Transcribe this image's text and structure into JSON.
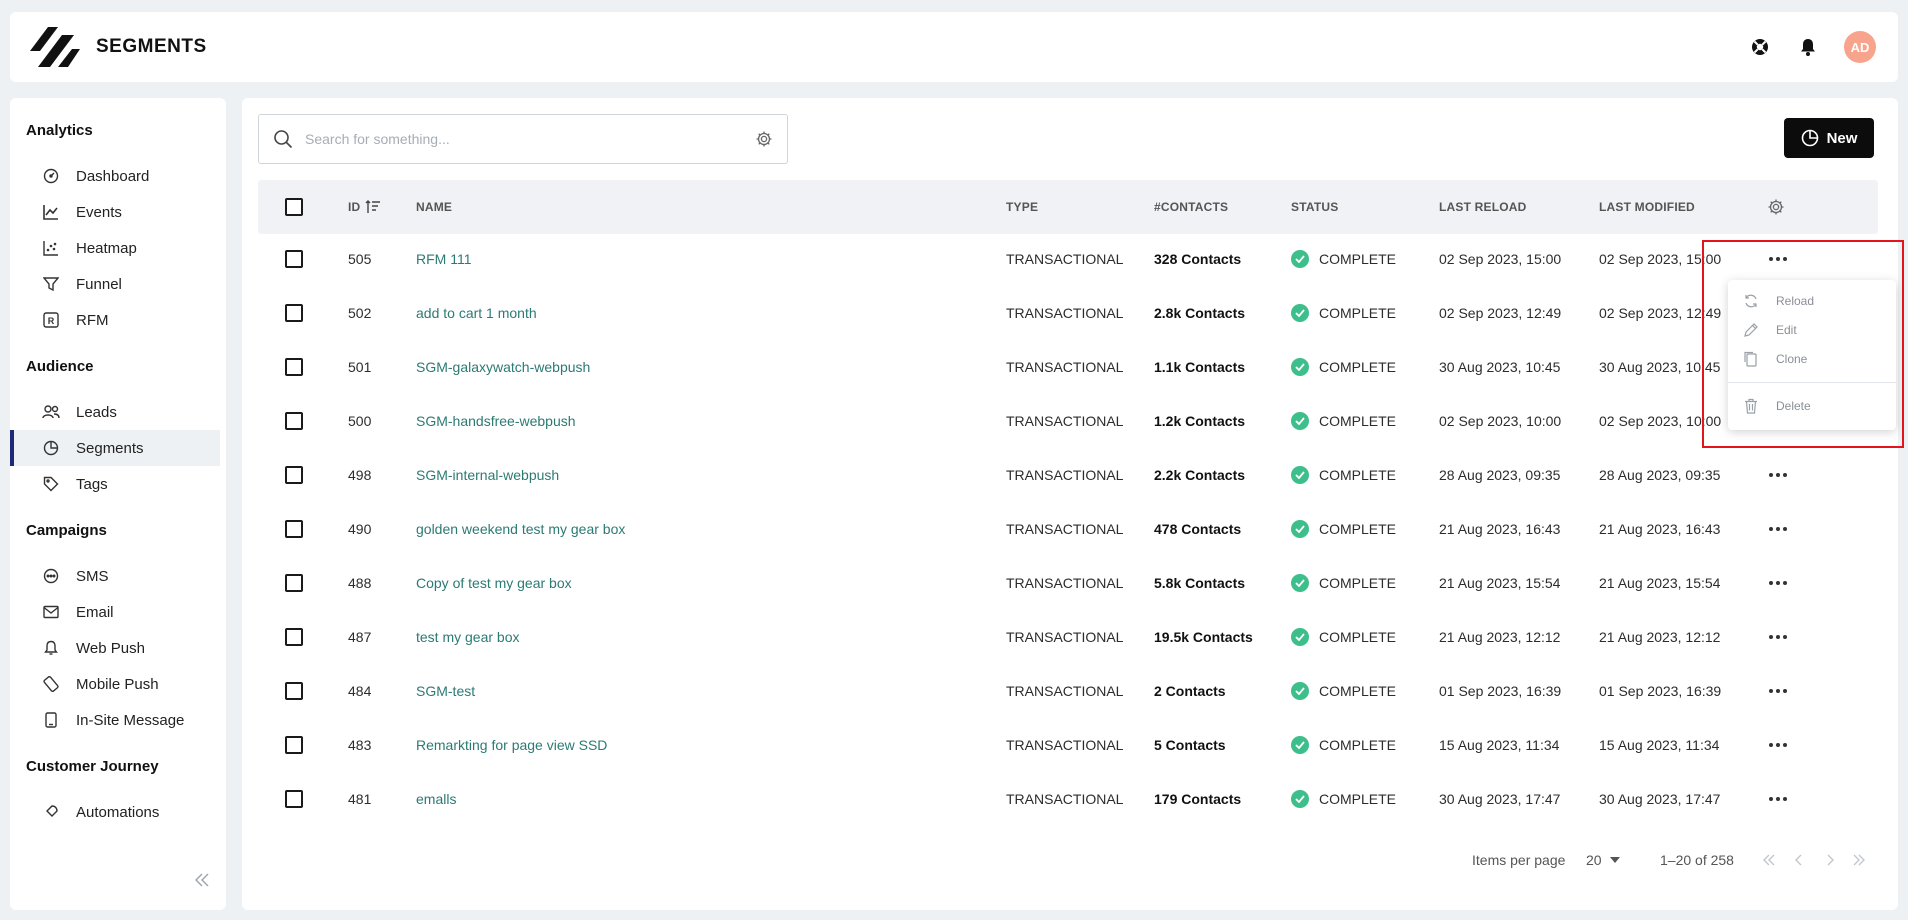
{
  "header": {
    "title": "SEGMENTS",
    "avatar_initials": "AD"
  },
  "sidebar": {
    "sections": [
      {
        "title": "Analytics",
        "items": [
          {
            "label": "Dashboard",
            "icon": "dashboard-icon"
          },
          {
            "label": "Events",
            "icon": "line-chart-icon"
          },
          {
            "label": "Heatmap",
            "icon": "scatter-icon"
          },
          {
            "label": "Funnel",
            "icon": "funnel-icon"
          },
          {
            "label": "RFM",
            "icon": "rfm-icon"
          }
        ]
      },
      {
        "title": "Audience",
        "items": [
          {
            "label": "Leads",
            "icon": "users-icon"
          },
          {
            "label": "Segments",
            "icon": "pie-icon",
            "active": true
          },
          {
            "label": "Tags",
            "icon": "tag-icon"
          }
        ]
      },
      {
        "title": "Campaigns",
        "items": [
          {
            "label": "SMS",
            "icon": "chat-icon"
          },
          {
            "label": "Email",
            "icon": "mail-icon"
          },
          {
            "label": "Web Push",
            "icon": "bell-icon"
          },
          {
            "label": "Mobile Push",
            "icon": "mobile-push-icon"
          },
          {
            "label": "In-Site Message",
            "icon": "tablet-icon"
          }
        ]
      },
      {
        "title": "Customer Journey",
        "items": [
          {
            "label": "Automations",
            "icon": "rocket-icon"
          }
        ]
      }
    ]
  },
  "toolbar": {
    "search_placeholder": "Search for something...",
    "new_label": "New"
  },
  "table": {
    "headers": {
      "id": "ID",
      "name": "NAME",
      "type": "TYPE",
      "contacts": "#CONTACTS",
      "status": "STATUS",
      "last_reload": "LAST RELOAD",
      "last_modified": "LAST MODIFIED"
    },
    "rows": [
      {
        "id": "505",
        "name": "RFM 111",
        "type": "TRANSACTIONAL",
        "contacts": "328 Contacts",
        "status": "COMPLETE",
        "last_reload": "02 Sep 2023, 15:00",
        "last_modified": "02 Sep 2023, 15:00"
      },
      {
        "id": "502",
        "name": "add to cart 1 month",
        "type": "TRANSACTIONAL",
        "contacts": "2.8k Contacts",
        "status": "COMPLETE",
        "last_reload": "02 Sep 2023, 12:49",
        "last_modified": "02 Sep 2023, 12:49"
      },
      {
        "id": "501",
        "name": "SGM-galaxywatch-webpush",
        "type": "TRANSACTIONAL",
        "contacts": "1.1k Contacts",
        "status": "COMPLETE",
        "last_reload": "30 Aug 2023, 10:45",
        "last_modified": "30 Aug 2023, 10:45"
      },
      {
        "id": "500",
        "name": "SGM-handsfree-webpush",
        "type": "TRANSACTIONAL",
        "contacts": "1.2k Contacts",
        "status": "COMPLETE",
        "last_reload": "02 Sep 2023, 10:00",
        "last_modified": "02 Sep 2023, 10:00"
      },
      {
        "id": "498",
        "name": "SGM-internal-webpush",
        "type": "TRANSACTIONAL",
        "contacts": "2.2k Contacts",
        "status": "COMPLETE",
        "last_reload": "28 Aug 2023, 09:35",
        "last_modified": "28 Aug 2023, 09:35"
      },
      {
        "id": "490",
        "name": "golden weekend test my gear box",
        "type": "TRANSACTIONAL",
        "contacts": "478 Contacts",
        "status": "COMPLETE",
        "last_reload": "21 Aug 2023, 16:43",
        "last_modified": "21 Aug 2023, 16:43"
      },
      {
        "id": "488",
        "name": "Copy of test my gear box",
        "type": "TRANSACTIONAL",
        "contacts": "5.8k Contacts",
        "status": "COMPLETE",
        "last_reload": "21 Aug 2023, 15:54",
        "last_modified": "21 Aug 2023, 15:54"
      },
      {
        "id": "487",
        "name": "test my gear box",
        "type": "TRANSACTIONAL",
        "contacts": "19.5k Contacts",
        "status": "COMPLETE",
        "last_reload": "21 Aug 2023, 12:12",
        "last_modified": "21 Aug 2023, 12:12"
      },
      {
        "id": "484",
        "name": "SGM-test",
        "type": "TRANSACTIONAL",
        "contacts": "2 Contacts",
        "status": "COMPLETE",
        "last_reload": "01 Sep 2023, 16:39",
        "last_modified": "01 Sep 2023, 16:39"
      },
      {
        "id": "483",
        "name": "Remarkting for page view SSD",
        "type": "TRANSACTIONAL",
        "contacts": "5 Contacts",
        "status": "COMPLETE",
        "last_reload": "15 Aug 2023, 11:34",
        "last_modified": "15 Aug 2023, 11:34"
      },
      {
        "id": "481",
        "name": "emalls",
        "type": "TRANSACTIONAL",
        "contacts": "179 Contacts",
        "status": "COMPLETE",
        "last_reload": "30 Aug 2023, 17:47",
        "last_modified": "30 Aug 2023, 17:47"
      }
    ]
  },
  "pagination": {
    "items_per_page_label": "Items per page",
    "items_per_page": "20",
    "range": "1–20 of 258"
  },
  "row_menu": {
    "items": [
      {
        "label": "Reload",
        "icon": "reload-icon"
      },
      {
        "label": "Edit",
        "icon": "pencil-icon"
      },
      {
        "label": "Clone",
        "icon": "copy-icon"
      },
      {
        "label": "Delete",
        "icon": "trash-icon"
      }
    ]
  },
  "colors": {
    "accent": "#1e2a78",
    "link": "#2c7a74",
    "status_complete": "#3dbf8c",
    "avatar": "#f8a48c",
    "highlight": "#e4141b"
  }
}
